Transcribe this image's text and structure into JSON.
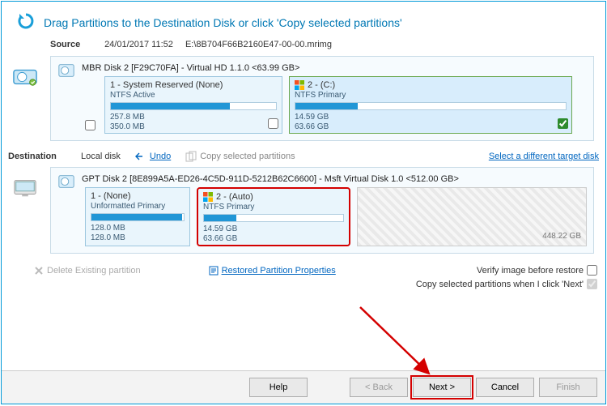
{
  "header": {
    "title": "Drag Partitions to the Destination Disk or click 'Copy selected partitions'"
  },
  "source": {
    "label": "Source",
    "timestamp": "24/01/2017 11:52",
    "path": "E:\\8B704F66B2160E47-00-00.mrimg",
    "disk_title": "MBR Disk 2 [F29C70FA] - Virtual HD 1.1.0  <63.99 GB>",
    "parts": [
      {
        "name": "1 - System Reserved  (None)",
        "type": "NTFS Active",
        "used": "257.8 MB",
        "total": "350.0 MB",
        "fill": 72,
        "checked": false,
        "windows": false
      },
      {
        "name": "2 -   (C:)",
        "type": "NTFS Primary",
        "used": "14.59 GB",
        "total": "63.66 GB",
        "fill": 23,
        "checked": true,
        "windows": true
      }
    ]
  },
  "dest": {
    "label": "Destination",
    "local": "Local disk",
    "undo": "Undo",
    "copy": "Copy selected partitions",
    "select_disk": "Select a different target disk",
    "disk_title": "GPT Disk 2 [8E899A5A-ED26-4C5D-911D-5212B62C6600] - Msft     Virtual Disk     1.0   <512.00 GB>",
    "parts": [
      {
        "name": "1 -   (None)",
        "type": "Unformatted Primary",
        "used": "128.0 MB",
        "total": "128.0 MB",
        "fill": 98,
        "windows": false
      },
      {
        "name": "2 -   (Auto)",
        "type": "NTFS Primary",
        "used": "14.59 GB",
        "total": "63.66 GB",
        "fill": 23,
        "windows": true
      }
    ],
    "unalloc": "448.22 GB"
  },
  "foot": {
    "delete": "Delete Existing partition",
    "restored": "Restored Partition Properties",
    "verify": "Verify image before restore",
    "auto_copy": "Copy selected partitions when I click 'Next'"
  },
  "buttons": {
    "help": "Help",
    "back": "< Back",
    "next": "Next >",
    "cancel": "Cancel",
    "finish": "Finish"
  }
}
